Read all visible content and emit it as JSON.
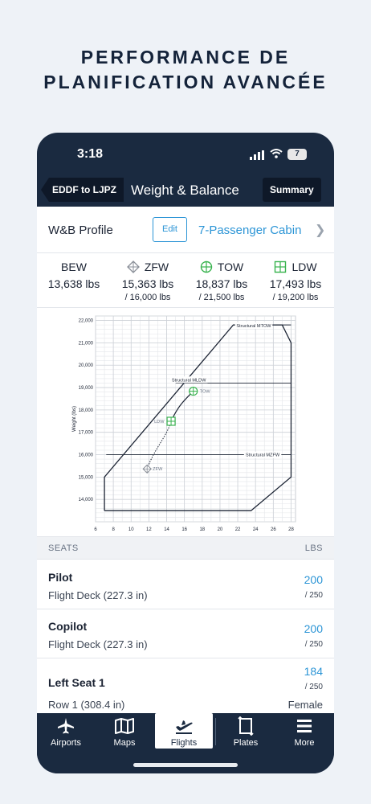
{
  "headline": {
    "line1": "PERFORMANCE DE",
    "line2": "PLANIFICATION AVANCÉE"
  },
  "status": {
    "time": "3:18",
    "battery": "7"
  },
  "nav": {
    "back_label": "EDDF to LJPZ",
    "title": "Weight & Balance",
    "summary_label": "Summary"
  },
  "profile": {
    "label": "W&B Profile",
    "edit_label": "Edit",
    "value": "7-Passenger Cabin"
  },
  "weights": [
    {
      "name": "BEW",
      "value": "13,638 lbs",
      "limit": ""
    },
    {
      "name": "ZFW",
      "value": "15,363 lbs",
      "limit": "/ 16,000 lbs"
    },
    {
      "name": "TOW",
      "value": "18,837 lbs",
      "limit": "/ 21,500 lbs"
    },
    {
      "name": "LDW",
      "value": "17,493 lbs",
      "limit": "/ 19,200 lbs"
    }
  ],
  "chart_data": {
    "type": "line",
    "title": "",
    "ylabel": "Weight (lbs)",
    "xlabel": "",
    "xlim": [
      6,
      28.5
    ],
    "ylim": [
      13000,
      22200
    ],
    "x_ticks": [
      6,
      8,
      10,
      12,
      14,
      16,
      18,
      20,
      22,
      24,
      26,
      28
    ],
    "y_ticks": [
      14000,
      15000,
      16000,
      17000,
      18000,
      19000,
      20000,
      21000,
      22000
    ],
    "grid": true,
    "envelope": [
      [
        7,
        13500
      ],
      [
        23.5,
        13500
      ],
      [
        28,
        15000
      ],
      [
        28,
        21000
      ],
      [
        27,
        21800
      ],
      [
        21.5,
        21800
      ],
      [
        7,
        15000
      ],
      [
        7,
        13500
      ]
    ],
    "limit_lines": [
      {
        "label": "Structural MTOW",
        "y": 21800
      },
      {
        "label": "Structural MLDW",
        "y": 19200
      },
      {
        "label": "Structural MZFW",
        "y": 16000
      }
    ],
    "points": [
      {
        "label": "ZFW",
        "x": 11.8,
        "y": 15363
      },
      {
        "label": "LDW",
        "x": 14.5,
        "y": 17493
      },
      {
        "label": "TOW",
        "x": 17,
        "y": 18837
      }
    ],
    "colors": {
      "envelope": "#1b2333",
      "point": "#37b24d",
      "zfw": "#8a8f98"
    }
  },
  "seats": {
    "header_left": "SEATS",
    "header_right": "LBS",
    "rows": [
      {
        "name": "Pilot",
        "location": "Flight Deck (227.3 in)",
        "value": "200",
        "max": "/ 250",
        "extra": ""
      },
      {
        "name": "Copilot",
        "location": "Flight Deck (227.3 in)",
        "value": "200",
        "max": "/ 250",
        "extra": ""
      },
      {
        "name": "Left Seat 1",
        "location": "Row 1 (308.4 in)",
        "value": "184",
        "max": "/ 250",
        "extra": "Female"
      }
    ]
  },
  "tabs": [
    {
      "label": "Airports",
      "icon": "plane-icon"
    },
    {
      "label": "Maps",
      "icon": "map-icon"
    },
    {
      "label": "Flights",
      "icon": "departure-icon"
    },
    {
      "label": "Plates",
      "icon": "plates-icon"
    },
    {
      "label": "More",
      "icon": "menu-icon"
    }
  ],
  "colors": {
    "accent": "#2c95d6",
    "navy": "#1a2a40",
    "green": "#37b24d"
  }
}
